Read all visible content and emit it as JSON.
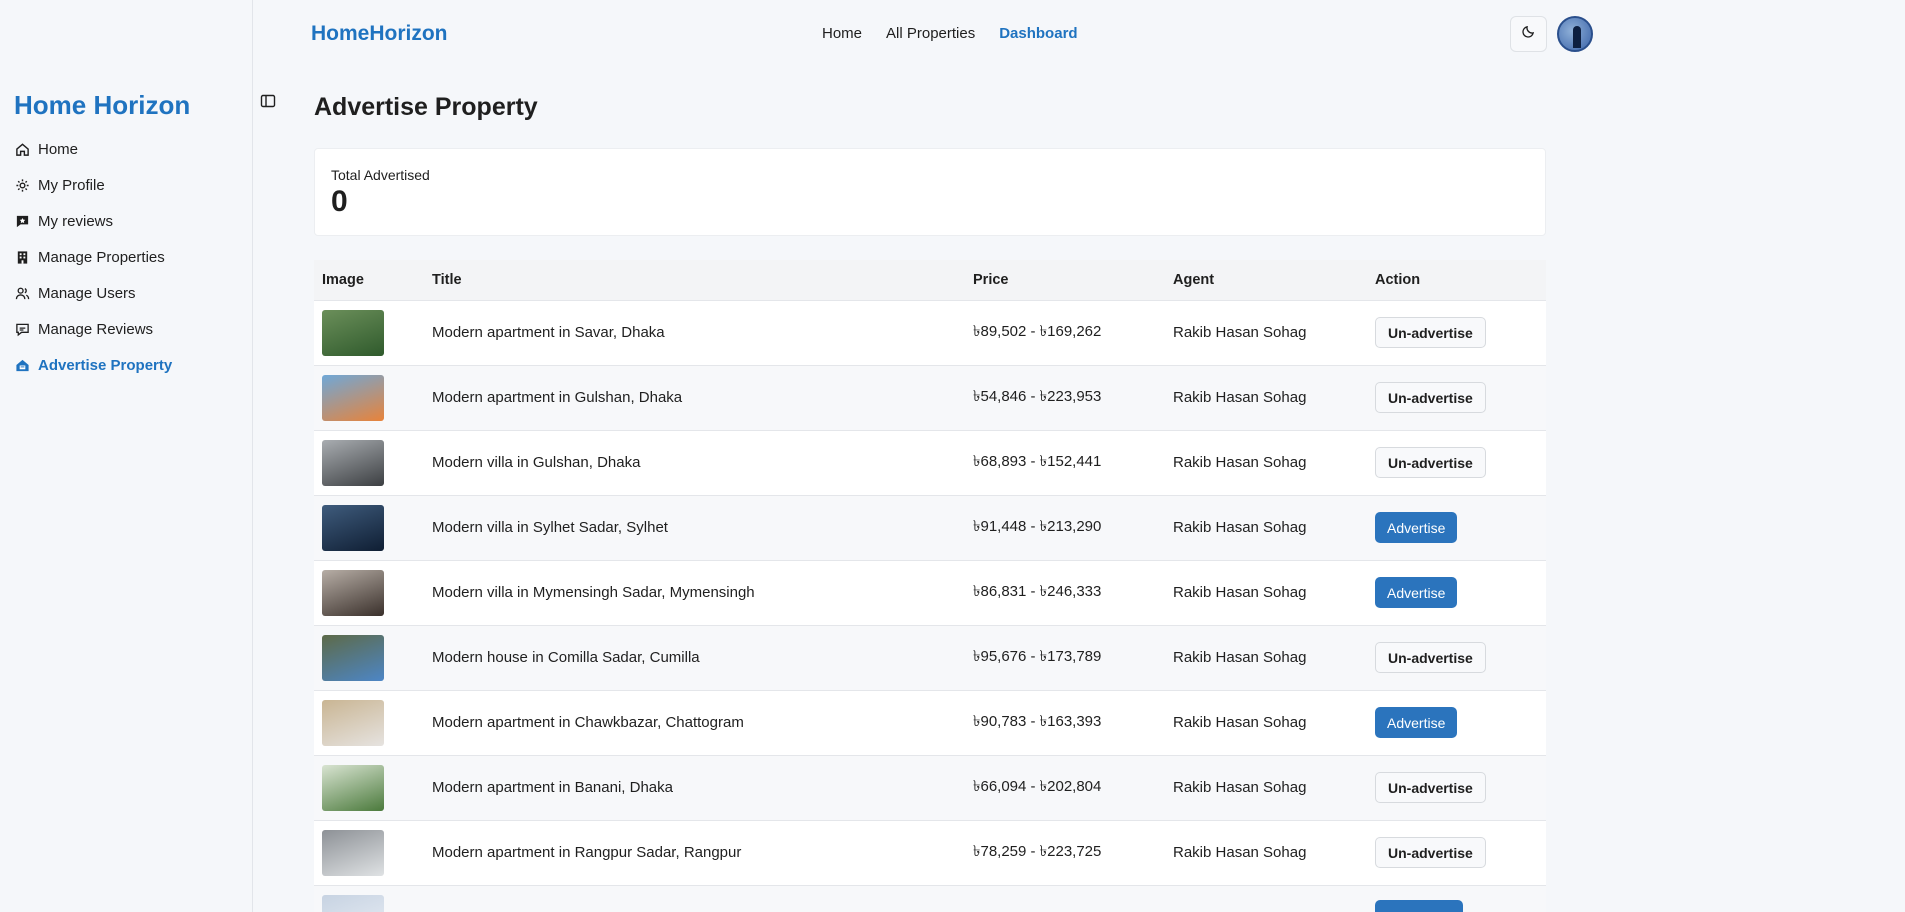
{
  "sidebar": {
    "brand": "Home Horizon",
    "items": [
      {
        "label": "Home",
        "icon": "home-icon"
      },
      {
        "label": "My Profile",
        "icon": "gear-icon"
      },
      {
        "label": "My reviews",
        "icon": "review-icon"
      },
      {
        "label": "Manage Properties",
        "icon": "building-icon"
      },
      {
        "label": "Manage Users",
        "icon": "users-icon"
      },
      {
        "label": "Manage Reviews",
        "icon": "chat-icon"
      },
      {
        "label": "Advertise Property",
        "icon": "house-advertise-icon",
        "active": true
      }
    ]
  },
  "navbar": {
    "logo": "HomeHorizon",
    "links": [
      "Home",
      "All Properties",
      "Dashboard"
    ],
    "active": "Dashboard",
    "theme_icon": "moon-icon"
  },
  "main": {
    "title": "Advertise Property",
    "stat": {
      "label": "Total Advertised",
      "value": "0"
    },
    "table": {
      "headers": [
        "Image",
        "Title",
        "Price",
        "Agent",
        "Action"
      ],
      "rows": [
        {
          "title": "Modern apartment in Savar, Dhaka",
          "price": "৳89,502 - ৳169,262",
          "agent": "Rakib Hasan Sohag",
          "action": "Un-advertise",
          "advertised": true,
          "thumb": [
            "#2f5a2c",
            "#6b8f5a"
          ]
        },
        {
          "title": "Modern apartment in Gulshan, Dhaka",
          "price": "৳54,846 - ৳223,953",
          "agent": "Rakib Hasan Sohag",
          "action": "Un-advertise",
          "advertised": true,
          "thumb": [
            "#e8833a",
            "#6fa8d8"
          ]
        },
        {
          "title": "Modern villa in Gulshan, Dhaka",
          "price": "৳68,893 - ৳152,441",
          "agent": "Rakib Hasan Sohag",
          "action": "Un-advertise",
          "advertised": true,
          "thumb": [
            "#3c3f42",
            "#a9adb1"
          ]
        },
        {
          "title": "Modern villa in Sylhet Sadar, Sylhet",
          "price": "৳91,448 - ৳213,290",
          "agent": "Rakib Hasan Sohag",
          "action": "Advertise",
          "advertised": false,
          "thumb": [
            "#0f1e33",
            "#3f5c7d"
          ]
        },
        {
          "title": "Modern villa in Mymensingh Sadar, Mymensingh",
          "price": "৳86,831 - ৳246,333",
          "agent": "Rakib Hasan Sohag",
          "action": "Advertise",
          "advertised": false,
          "thumb": [
            "#3a302b",
            "#b7aea6"
          ]
        },
        {
          "title": "Modern house in Comilla Sadar, Cumilla",
          "price": "৳95,676 - ৳173,789",
          "agent": "Rakib Hasan Sohag",
          "action": "Un-advertise",
          "advertised": true,
          "thumb": [
            "#4d86c6",
            "#5d6a48"
          ]
        },
        {
          "title": "Modern apartment in Chawkbazar, Chattogram",
          "price": "৳90,783 - ৳163,393",
          "agent": "Rakib Hasan Sohag",
          "action": "Advertise",
          "advertised": false,
          "thumb": [
            "#e6e3e0",
            "#c9b593"
          ]
        },
        {
          "title": "Modern apartment in Banani, Dhaka",
          "price": "৳66,094 - ৳202,804",
          "agent": "Rakib Hasan Sohag",
          "action": "Un-advertise",
          "advertised": true,
          "thumb": [
            "#4b7a3c",
            "#d9e4d2"
          ]
        },
        {
          "title": "Modern apartment in Rangpur Sadar, Rangpur",
          "price": "৳78,259 - ৳223,725",
          "agent": "Rakib Hasan Sohag",
          "action": "Un-advertise",
          "advertised": true,
          "thumb": [
            "#dfe2e4",
            "#8d9196"
          ]
        },
        {
          "title": "",
          "price": "",
          "agent": "",
          "action": "",
          "advertised": false,
          "thumb": [
            "#e9eef5",
            "#c7d3e2"
          ]
        }
      ]
    }
  }
}
